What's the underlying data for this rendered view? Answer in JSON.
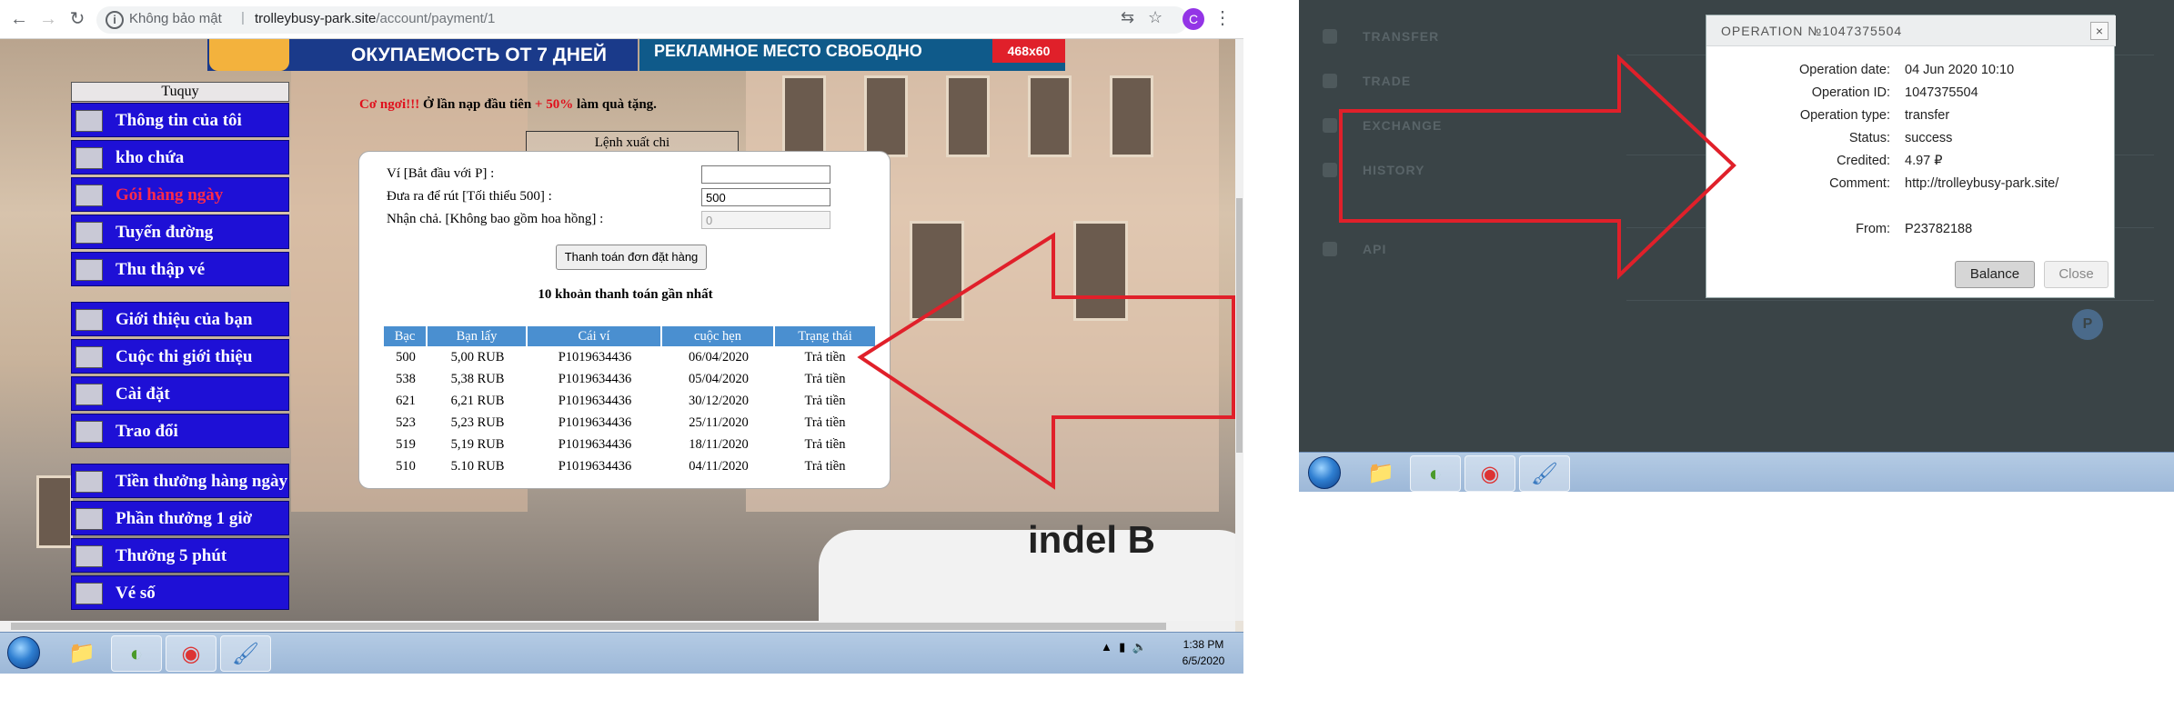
{
  "browser": {
    "security_label": "Không bảo mật",
    "url_host": "trolleybusy-park.site",
    "url_path": "/account/payment/1",
    "profile_initial": "C"
  },
  "banners": {
    "left_text": "ОКУПАЕМОСТЬ ОТ 7 ДНЕЙ",
    "right_text": "РЕКЛАМНОЕ  МЕСТО СВОБОДНО",
    "right_size": "468x60"
  },
  "menu": {
    "title": "Tuquy",
    "items": [
      {
        "label": "Thông tin của tôi"
      },
      {
        "label": "kho chứa"
      },
      {
        "label": "Gói hàng ngày"
      },
      {
        "label": "Tuyến đường"
      },
      {
        "label": "Thu thập vé"
      },
      {
        "label": "Giới thiệu của bạn"
      },
      {
        "label": "Cuộc thi giới thiệu"
      },
      {
        "label": "Cài đặt"
      },
      {
        "label": "Trao đổi"
      },
      {
        "label": "Tiền thưởng hàng ngày"
      },
      {
        "label": "Phần thưởng 1 giờ"
      },
      {
        "label": "Thưởng 5 phút"
      },
      {
        "label": "Vé số"
      }
    ]
  },
  "promo": {
    "red_start": "Cơ ngơi!!!",
    "middle": " Ở lần nạp đầu tiên ",
    "red_percent": "+ 50%",
    "end": " làm quà tặng."
  },
  "withdraw": {
    "tab_label": "Lệnh xuất chi",
    "wallet_label": "Ví [Bắt đầu với P] :",
    "wallet_value": "",
    "amount_label": "Đưa ra để rút [Tối thiểu 500] :",
    "amount_value": "500",
    "receive_label": "Nhận chả. [Không bao gồm hoa hồng] :",
    "receive_value": "0",
    "submit_label": "Thanh toán đơn đặt hàng",
    "history_title": "10 khoản thanh toán gần nhất",
    "columns": [
      "Bạc",
      "Bạn lấy",
      "Cái ví",
      "cuộc hẹn",
      "Trạng thái"
    ],
    "rows": [
      [
        "500",
        "5,00 RUB",
        "P1019634436",
        "06/04/2020",
        "Trả tiền"
      ],
      [
        "538",
        "5,38 RUB",
        "P1019634436",
        "05/04/2020",
        "Trả tiền"
      ],
      [
        "621",
        "6,21 RUB",
        "P1019634436",
        "30/12/2020",
        "Trả tiền"
      ],
      [
        "523",
        "5,23 RUB",
        "P1019634436",
        "25/11/2020",
        "Trả tiền"
      ],
      [
        "519",
        "5,19 RUB",
        "P1019634436",
        "18/11/2020",
        "Trả tiền"
      ],
      [
        "510",
        "5.10 RUB",
        "P1019634436",
        "04/11/2020",
        "Trả tiền"
      ]
    ]
  },
  "photo": {
    "bus_logo": "indel B"
  },
  "taskbar_left": {
    "time": "1:38 PM",
    "date": "6/5/2020"
  },
  "wallet": {
    "sidebar": [
      "TRANSFER",
      "TRADE",
      "EXCHANGE",
      "HISTORY",
      "API"
    ],
    "operation": {
      "title": "OPERATION №1047375504",
      "fields": [
        {
          "key": "Operation date:",
          "value": "04 Jun 2020 10:10"
        },
        {
          "key": "Operation ID:",
          "value": "1047375504"
        },
        {
          "key": "Operation type:",
          "value": "transfer"
        },
        {
          "key": "Status:",
          "value": "success"
        },
        {
          "key": "Credited:",
          "value": "4.97 ₽"
        },
        {
          "key": "Comment:",
          "value": "http://trolleybusy-park.site/"
        },
        {
          "key": "From:",
          "value": "P23782188"
        }
      ],
      "balance_label": "Balance",
      "close_label": "Close"
    }
  },
  "colors": {
    "menu_blue": "#1e10d6",
    "active_red": "#ff2a4a",
    "arrow_red": "#e0202a",
    "table_header": "#4a8fd0"
  }
}
